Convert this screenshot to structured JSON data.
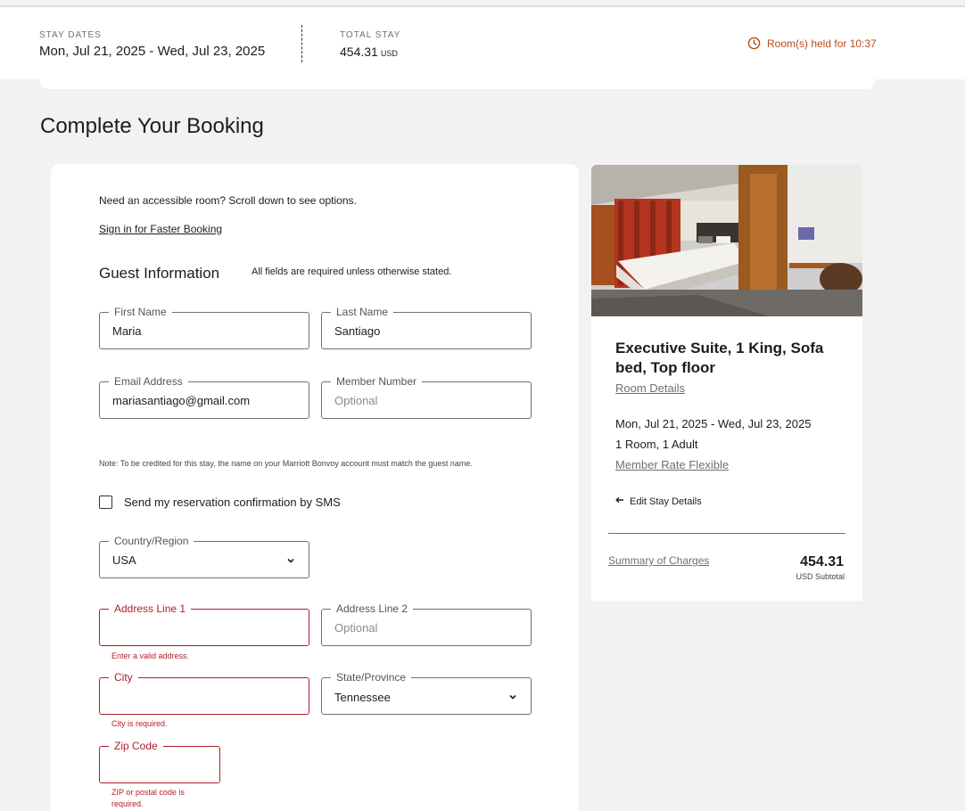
{
  "header": {
    "stay_dates_label": "STAY DATES",
    "stay_dates_value": "Mon, Jul 21, 2025 - Wed, Jul 23, 2025",
    "total_stay_label": "TOTAL STAY",
    "total_stay_amount": "454.31",
    "total_stay_currency": "USD",
    "held_text": "Room(s) held for 10:37"
  },
  "page": {
    "title": "Complete Your Booking"
  },
  "form": {
    "accessible_note": "Need an accessible room? Scroll down to see options.",
    "sign_in_link": "Sign in for Faster Booking",
    "guest_info_title": "Guest Information",
    "required_note": "All fields are required unless otherwise stated.",
    "first_name": {
      "label": "First Name",
      "value": "Maria"
    },
    "last_name": {
      "label": "Last Name",
      "value": "Santiago"
    },
    "email": {
      "label": "Email Address",
      "value": "mariasantiago@gmail.com"
    },
    "member_number": {
      "label": "Member Number",
      "placeholder": "Optional"
    },
    "credit_note": "Note: To be credited for this stay, the name on your Marriott Bonvoy account must match the guest name.",
    "sms_label": "Send my reservation confirmation by SMS",
    "country": {
      "label": "Country/Region",
      "value": "USA"
    },
    "address1": {
      "label": "Address Line 1",
      "error": "Enter a valid address."
    },
    "address2": {
      "label": "Address Line 2",
      "placeholder": "Optional"
    },
    "city": {
      "label": "City",
      "error": "City is required."
    },
    "state": {
      "label": "State/Province",
      "value": "Tennessee"
    },
    "zip": {
      "label": "Zip Code",
      "error_line1": "ZIP or postal code is",
      "error_line2": "required."
    }
  },
  "summary": {
    "room_name": "Executive Suite, 1 King, Sofa bed, Top floor",
    "room_details_link": "Room Details",
    "dates": "Mon, Jul 21, 2025 - Wed, Jul 23, 2025",
    "guests": "1 Room, 1 Adult",
    "rate_link": "Member Rate Flexible",
    "edit_stay": "Edit Stay Details",
    "summary_link": "Summary of Charges",
    "amount": "454.31",
    "subtotal_label": "USD Subtotal"
  },
  "colors": {
    "accent_orange": "#b84c1a",
    "error_red": "#b01e2a",
    "background": "#f2f2f2"
  },
  "icons": {
    "timer": "clock-icon",
    "select": "chevron-down-icon",
    "back": "arrow-left-icon"
  }
}
